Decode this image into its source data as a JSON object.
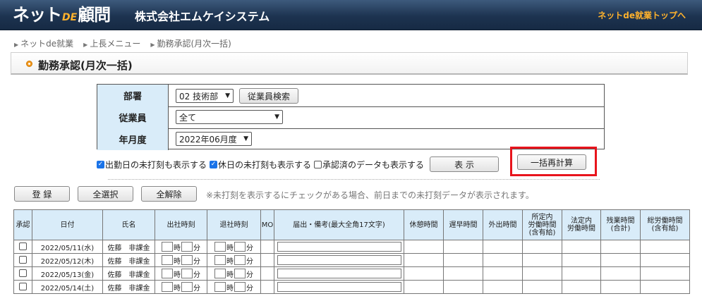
{
  "header": {
    "logo_part1": "ネット",
    "logo_part2": "DE",
    "logo_part3": "顧問",
    "company": "株式会社エムケイシステム",
    "top_link": "ネットde就業トップへ"
  },
  "breadcrumb": [
    "ネットde就業",
    "上長メニュー",
    "勤務承認(月次一括)"
  ],
  "page_title": "勤務承認(月次一括)",
  "form": {
    "department_label": "部署",
    "department_value": "02 技術部",
    "employee_search_button": "従業員検索",
    "employee_label": "従業員",
    "employee_value": "全て",
    "period_label": "年月度",
    "period_value": "2022年06月度"
  },
  "options": {
    "show_missing_workday": "出勤日の未打刻も表示する",
    "show_missing_workday_checked": true,
    "show_missing_holiday": "休日の未打刻も表示する",
    "show_missing_holiday_checked": true,
    "show_approved": "承認済のデータも表示する",
    "show_approved_checked": false,
    "display_button": "表 示",
    "recalc_button": "一括再計算"
  },
  "actions": {
    "register_button": "登 録",
    "select_all_button": "全選択",
    "deselect_all_button": "全解除",
    "note": "※未打刻を表示するにチェックがある場合、前日までの未打刻データが表示されます。"
  },
  "table": {
    "headers": {
      "approve": "承認",
      "date": "日付",
      "name": "氏名",
      "clock_in": "出社時刻",
      "clock_out": "退社時刻",
      "mo": "MO",
      "remarks": "届出・備考(最大全角17文字)",
      "break": "休憩時間",
      "late": "遅早時間",
      "out": "外出時間",
      "scheduled_line1": "所定内",
      "scheduled_line2": "労働時間",
      "scheduled_line3": "(含有給)",
      "legal_line1": "法定内",
      "legal_line2": "労働時間",
      "overtime_line1": "残業時間",
      "overtime_line2": "(合計)",
      "total_line1": "総労働時間",
      "total_line2": "(含有給)"
    },
    "hour_unit": "時",
    "minute_unit": "分",
    "rows": [
      {
        "date": "2022/05/11(水)",
        "name": "佐藤　非課金"
      },
      {
        "date": "2022/05/12(木)",
        "name": "佐藤　非課金"
      },
      {
        "date": "2022/05/13(金)",
        "name": "佐藤　非課金"
      },
      {
        "date": "2022/05/14(土)",
        "name": "佐藤　非課金"
      }
    ]
  }
}
